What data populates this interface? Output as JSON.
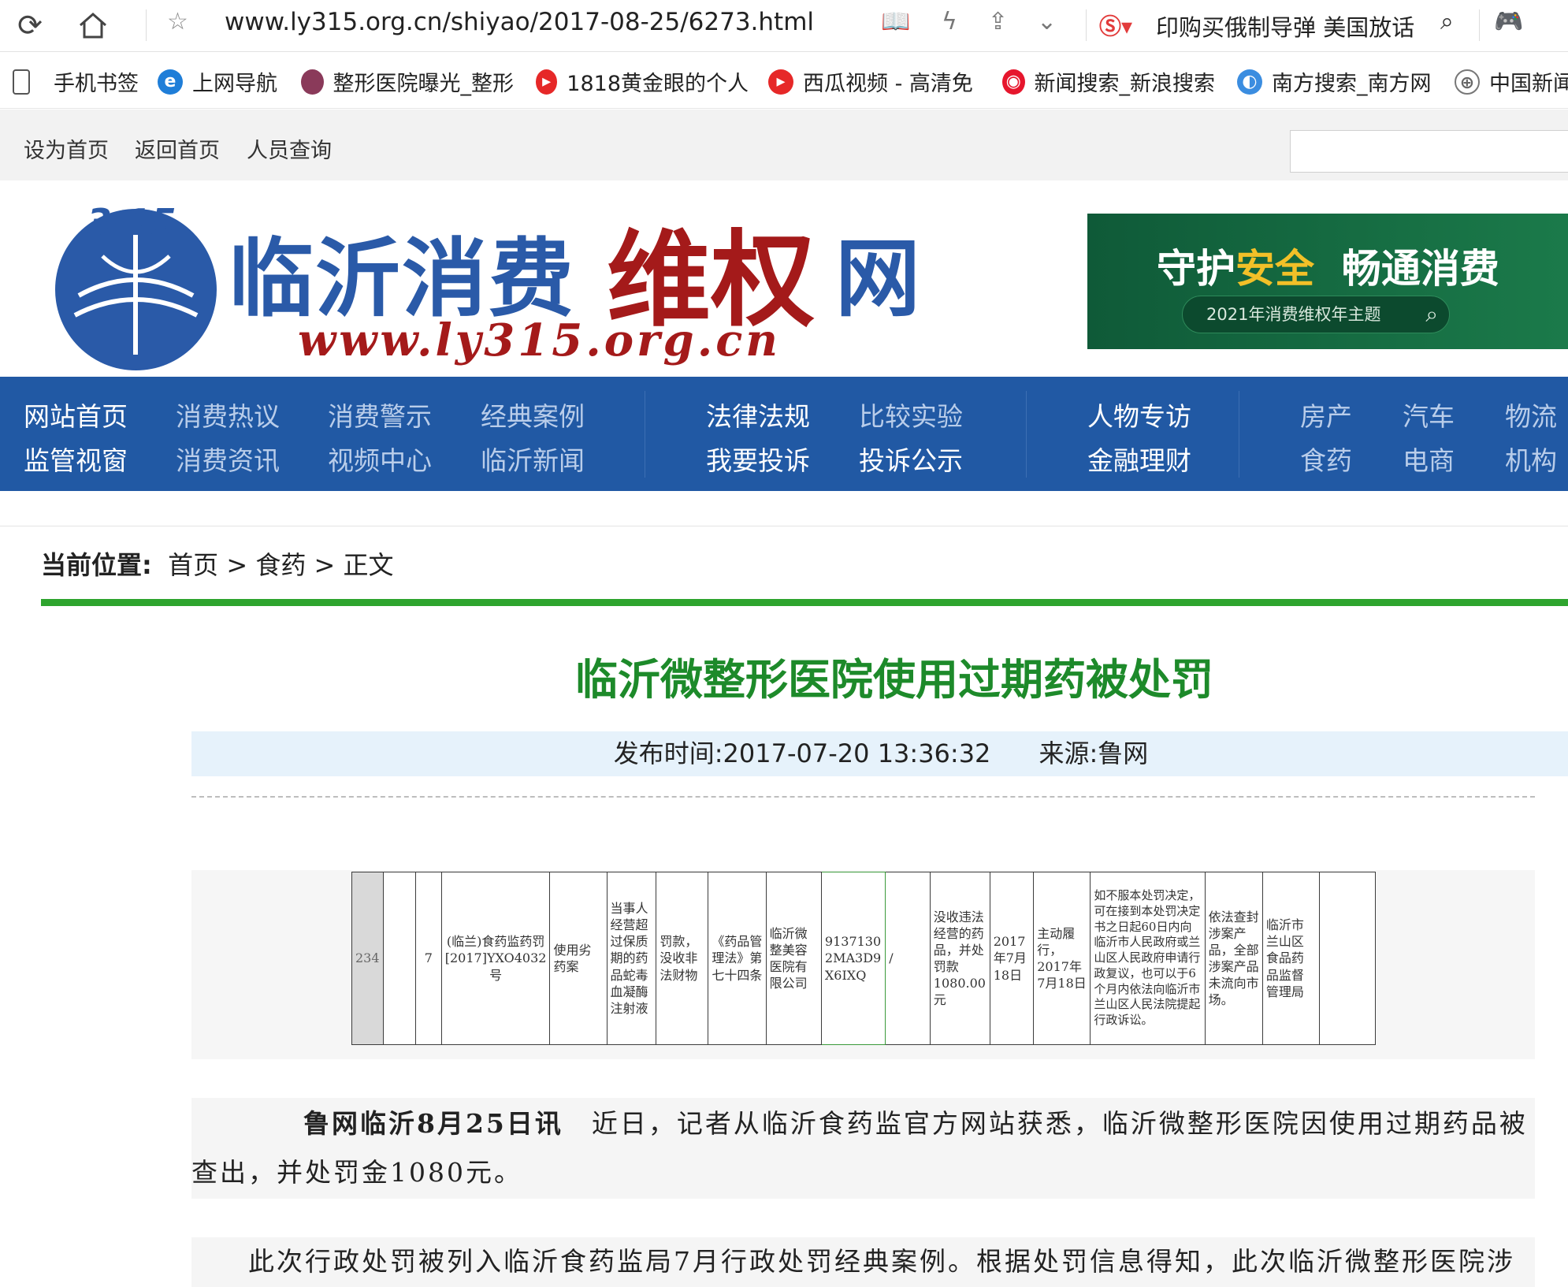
{
  "browser": {
    "url": "www.ly315.org.cn/shiyao/2017-08-25/6273.html",
    "search_text": "印购买俄制导弹 美国放话",
    "icons": [
      "refresh-icon",
      "home-icon",
      "star-icon",
      "reader-icon",
      "lightning-icon",
      "share-icon",
      "chevron-down-icon",
      "search-engine-icon",
      "search-icon",
      "game-icon"
    ]
  },
  "bookmarks": [
    {
      "label": "手机书签",
      "icon": "phone-icon"
    },
    {
      "label": "上网导航",
      "icon": "ie-icon"
    },
    {
      "label": "整形医院曝光_整形",
      "icon": "clinic-logo-icon"
    },
    {
      "label": "1818黄金眼的个人",
      "icon": "video-play-icon"
    },
    {
      "label": "西瓜视频 - 高清免",
      "icon": "video-play-icon"
    },
    {
      "label": "新闻搜索_新浪搜索",
      "icon": "weibo-icon"
    },
    {
      "label": "南方搜索_南方网",
      "icon": "nanfang-icon"
    },
    {
      "label": "中国新闻",
      "icon": "globe-icon"
    }
  ],
  "site_top": {
    "links": [
      "设为首页",
      "返回首页",
      "人员查询"
    ]
  },
  "banner": {
    "logo_badge": "3·15",
    "title_part1": "临沂消费",
    "title_part2": "维权",
    "title_part3": "网",
    "site_url": "www.ly315.org.cn",
    "ad_line_a": "守护",
    "ad_line_b": "安全",
    "ad_line_c": "畅通消费",
    "ad_theme": "2021年消费维权年主题"
  },
  "nav": {
    "row1": [
      "网站首页",
      "消费热议",
      "消费警示",
      "经典案例",
      "法律法规",
      "比较实验",
      "人物专访",
      "房产",
      "汽车",
      "物流"
    ],
    "row2": [
      "监管视窗",
      "消费资讯",
      "视频中心",
      "临沂新闻",
      "我要投诉",
      "投诉公示",
      "金融理财",
      "食药",
      "电商",
      "机构"
    ]
  },
  "breadcrumb": {
    "label": "当前位置:",
    "path": "首页 > 食药 > 正文"
  },
  "article": {
    "title": "临沂微整形医院使用过期药被处罚",
    "publish_label": "发布时间:",
    "publish_time": "2017-07-20 13:36:32",
    "source_label": "来源:",
    "source": "鲁网",
    "table_row": {
      "row_no": "234",
      "seq": "7",
      "case_no": "(临兰)食药监药罚[2017]YXO4032号",
      "case_name": "使用劣药案",
      "facts": "当事人经营超过保质期的药品蛇毒血凝酶注射液",
      "penalty_type": "罚款，没收非法财物",
      "basis": "《药品管理法》第七十四条",
      "party": "临沂微整美容医院有限公司",
      "credit_code": "91371302MA3D9X6IXQ",
      "legal_rep": "/",
      "content": "没收违法经营的药品，并处罚款1080.00元",
      "decision_date": "2017年7月18日",
      "fulfillment": "主动履行，2017年7月18日",
      "remedy": "如不服本处罚决定，可在接到本处罚决定书之日起60日内向临沂市人民政府或兰山区人民政府申请行政复议，也可以于6个月内依法向临沂市兰山区人民法院提起行政诉讼。",
      "note": "依法查封涉案产品，全部涉案产品未流向市场。",
      "authority": "临沂市兰山区食品药品监督管理局"
    },
    "para1_lead": "鲁网临沂8月25日讯",
    "para1_body": "　近日，记者从临沂食药监官方网站获悉，临沂微整形医院因使用过期药品被查出，并处罚金1080元。",
    "para2": "此次行政处罚被列入临沂食药监局7月行政处罚经典案例。根据处罚信息得知，此次临沂微整形医院涉"
  },
  "colors": {
    "nav_blue": "#2159a4",
    "title_green": "#1d8a2a",
    "rule_green": "#2ea42e",
    "logo_red": "#a41a1a"
  }
}
